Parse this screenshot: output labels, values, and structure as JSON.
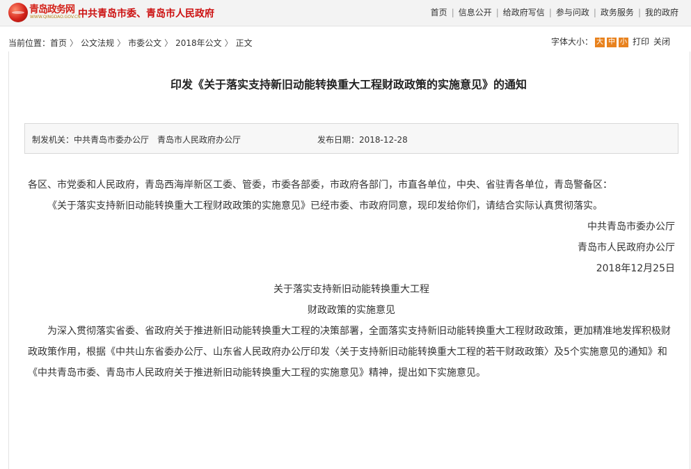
{
  "header": {
    "logo_text": "青岛政务网",
    "logo_sub": "WWW.QINGDAO.GOV.CN",
    "site_org": "中共青岛市委、青岛市人民政府",
    "nav": [
      "首页",
      "信息公开",
      "给政府写信",
      "参与问政",
      "政务服务",
      "我的政府"
    ]
  },
  "breadcrumb": {
    "prefix": "当前位置：",
    "items": [
      "首页",
      "公文法规",
      "市委公文",
      "2018年公文",
      "正文"
    ],
    "separator": "〉"
  },
  "tools": {
    "font_size_label": "字体大小：",
    "sizes": [
      "大",
      "中",
      "小"
    ],
    "print": "打印",
    "close": "关闭"
  },
  "article": {
    "title": "印发《关于落实支持新旧动能转换重大工程财政政策的实施意见》的通知",
    "issuer_label": "制发机关：",
    "issuer": "中共青岛市委办公厅　青岛市人民政府办公厅",
    "date_label": "发布日期：",
    "date": "2018-12-28",
    "recipients": "各区、市党委和人民政府，青岛西海岸新区工委、管委，市委各部委，市政府各部门，市直各单位，中央、省驻青各单位，青岛警备区：",
    "para1": "《关于落实支持新旧动能转换重大工程财政政策的实施意见》已经市委、市政府同意，现印发给你们，请结合实际认真贯彻落实。",
    "sign1": "中共青岛市委办公厅",
    "sign2": "青岛市人民政府办公厅",
    "sign_date": "2018年12月25日",
    "sub_title1": "关于落实支持新旧动能转换重大工程",
    "sub_title2": "财政政策的实施意见",
    "para2": "为深入贯彻落实省委、省政府关于推进新旧动能转换重大工程的决策部署，全面落实支持新旧动能转换重大工程财政政策，更加精准地发挥积极财政政策作用，根据《中共山东省委办公厅、山东省人民政府办公厅印发〈关于支持新旧动能转换重大工程的若干财政政策〉及5个实施意见的通知》和《中共青岛市委、青岛市人民政府关于推进新旧动能转换重大工程的实施意见》精神，提出如下实施意见。"
  },
  "colors": {
    "brand_red": "#cc1010",
    "size_button": "#e8821e"
  }
}
